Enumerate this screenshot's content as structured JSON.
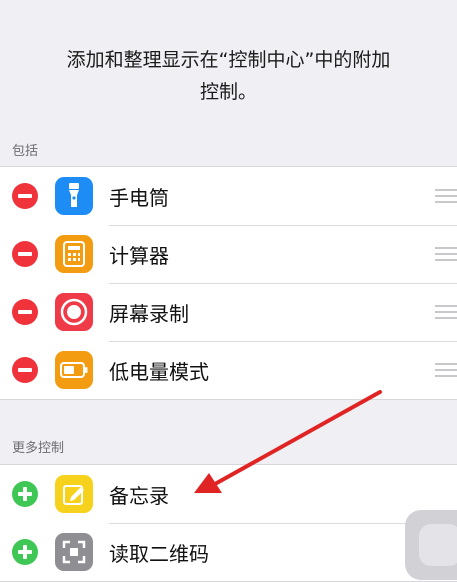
{
  "header": {
    "line1": "添加和整理显示在“控制中心”中的附加",
    "line2": "控制。"
  },
  "included": {
    "title": "包括",
    "items": [
      {
        "label": "手电筒",
        "icon": "flashlight-icon",
        "color": "#1e8cf5"
      },
      {
        "label": "计算器",
        "icon": "calculator-icon",
        "color": "#f39c12"
      },
      {
        "label": "屏幕录制",
        "icon": "screen-record-icon",
        "color": "#ef3b47"
      },
      {
        "label": "低电量模式",
        "icon": "battery-icon",
        "color": "#f39c12"
      }
    ]
  },
  "more": {
    "title": "更多控制",
    "items": [
      {
        "label": "备忘录",
        "icon": "notes-icon",
        "color": "#f6d21c"
      },
      {
        "label": "读取二维码",
        "icon": "qr-scan-icon",
        "color": "#8e8e93"
      }
    ]
  },
  "colors": {
    "remove": "#f0323a",
    "add": "#3ec755",
    "annotation_arrow": "#e02424"
  }
}
